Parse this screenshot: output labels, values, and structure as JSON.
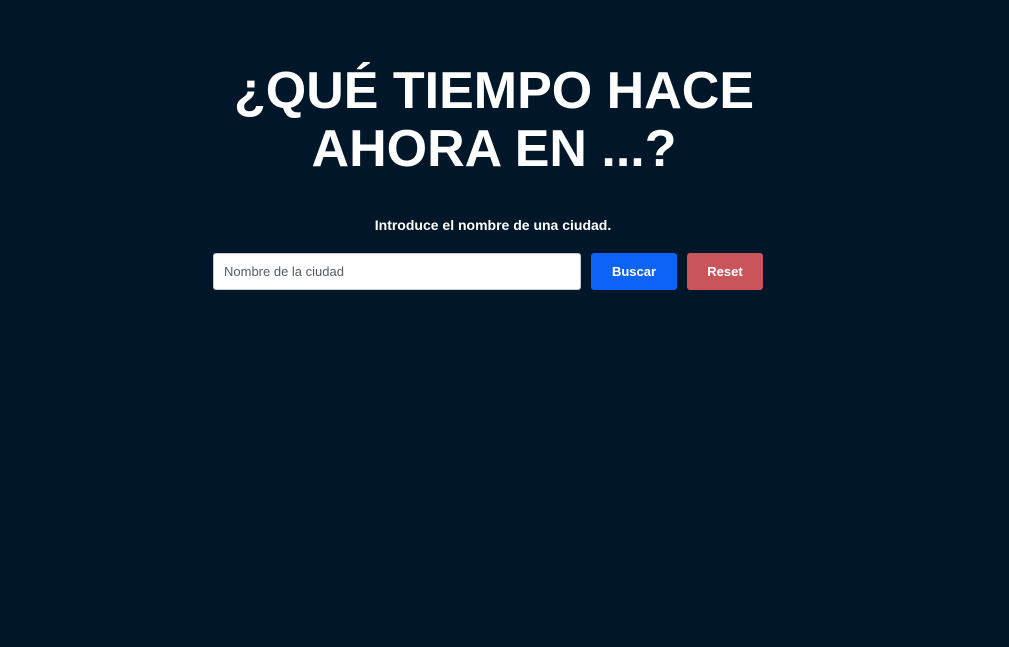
{
  "header": {
    "title_line1": "¿QUÉ TIEMPO HACE",
    "title_line2": "AHORA EN ...?"
  },
  "form": {
    "instruction": "Introduce el nombre de una ciudad.",
    "city_input": {
      "placeholder": "Nombre de la ciudad",
      "value": ""
    },
    "search_label": "Buscar",
    "reset_label": "Reset"
  },
  "colors": {
    "background": "#001629",
    "search_button": "#0d63f8",
    "reset_button": "#c9555a"
  }
}
